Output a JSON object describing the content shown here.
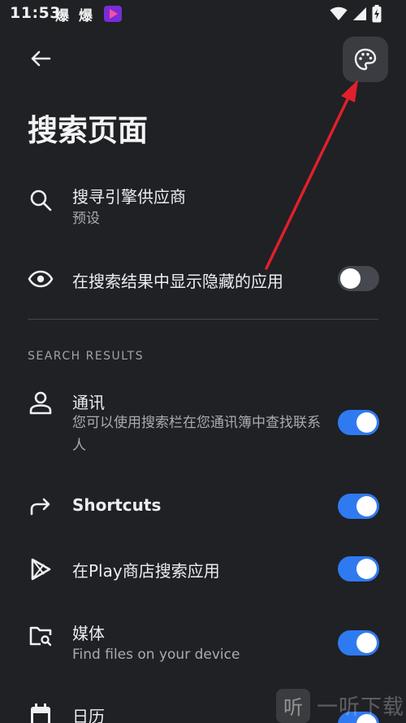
{
  "status_bar": {
    "time": "11:53",
    "notification_1": "爆",
    "notification_2": "爆"
  },
  "header": {
    "title": "搜索页面"
  },
  "settings": {
    "search_engine": {
      "title": "搜寻引擎供应商",
      "subtitle": "预设"
    },
    "show_hidden": {
      "title": "在搜索结果中显示隐藏的应用",
      "enabled": false
    }
  },
  "section": {
    "title": "SEARCH RESULTS"
  },
  "results": {
    "contacts": {
      "title": "通讯",
      "subtitle": "您可以使用搜索栏在您通讯簿中查找联系人",
      "enabled": true
    },
    "shortcuts": {
      "title": "Shortcuts",
      "enabled": true
    },
    "play_store": {
      "title": "在Play商店搜索应用",
      "enabled": true
    },
    "media": {
      "title": "媒体",
      "subtitle": "Find files on your device",
      "enabled": true
    },
    "calendar": {
      "title": "日历",
      "enabled": true
    }
  },
  "watermark": {
    "glyph": "听",
    "text": "一听下载"
  },
  "colors": {
    "background": "#1f2125",
    "toggle_on": "#2f7af1",
    "toggle_off": "#45484e",
    "annotation_arrow": "#e0202a"
  }
}
